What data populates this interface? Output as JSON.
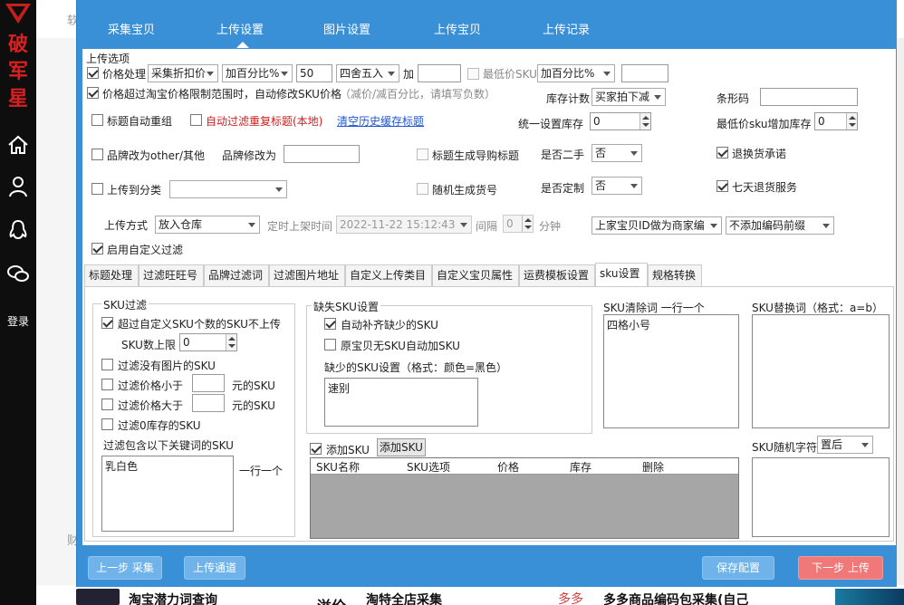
{
  "sidebar": {
    "brand_chars": [
      "破",
      "军",
      "星"
    ],
    "login_label": "登录"
  },
  "background": {
    "top_char": "软",
    "side_char": "财",
    "bottom": [
      "淘宝潜力词查询",
      "溢价",
      "淘特全店采集",
      "多多",
      "多多商品编码包采集(自己"
    ]
  },
  "dialog": {
    "tabs": [
      "采集宝贝",
      "上传设置",
      "图片设置",
      "上传宝贝",
      "上传记录"
    ],
    "active_tab": 1,
    "section_title": "上传选项",
    "price": {
      "label": "价格处理",
      "checked": true,
      "mode": "采集折扣价",
      "calc": "加百分比%",
      "value": "50",
      "rounding": "四舍五入",
      "add_label": "加",
      "add_value": "",
      "min_label": "最低价SKU",
      "min_checked": false,
      "min_mode": "加百分比%",
      "min_value": ""
    },
    "over_limit": {
      "label": "价格超过淘宝价格限制范围时，自动修改SKU价格",
      "checked": true,
      "hint": "（减价/减百分比，请填写负数）"
    },
    "stock": {
      "label": "库存计数",
      "value": "买家拍下减"
    },
    "barcode": {
      "label": "条形码",
      "value": ""
    },
    "title_regroup": {
      "label": "标题自动重组",
      "checked": false
    },
    "dedupe": {
      "label": "自动过滤重复标题(本地)",
      "checked": false
    },
    "clear_link": "清空历史缓存标题",
    "unify_stock": {
      "label": "统一设置库存",
      "value": "0"
    },
    "min_sku_stock": {
      "label": "最低价sku增加库存",
      "value": "0"
    },
    "brand_other": {
      "label": "品牌改为other/其他",
      "checked": false
    },
    "brand_change": {
      "label": "品牌修改为",
      "value": ""
    },
    "shopping_title": {
      "label": "标题生成导购标题",
      "checked": false
    },
    "second_hand": {
      "label": "是否二手",
      "value": "否"
    },
    "return_promise": {
      "label": "退换货承诺",
      "checked": true
    },
    "upload_category": {
      "label": "上传到分类",
      "checked": false,
      "value": ""
    },
    "random_code": {
      "label": "随机生成货号",
      "checked": false
    },
    "custom_made": {
      "label": "是否定制",
      "value": "否"
    },
    "seven_days": {
      "label": "七天退货服务",
      "checked": true
    },
    "upload_method": {
      "label": "上传方式",
      "value": "放入仓库"
    },
    "timed": {
      "label": "定时上架时间",
      "value": "2022-11-22 15:12:43",
      "interval_label": "间隔",
      "interval_value": "0",
      "unit": "分钟"
    },
    "merchant_code": "上家宝贝ID做为商家编",
    "prefix": "不添加编码前缀",
    "custom_filter": {
      "label": "启用自定义过滤",
      "checked": true
    },
    "subtabs": [
      "标题处理",
      "过滤旺旺号",
      "品牌过滤词",
      "过滤图片地址",
      "自定义上传类目",
      "自定义宝贝属性",
      "运费模板设置",
      "sku设置",
      "规格转换"
    ],
    "active_subtab": 7,
    "sku_filter": {
      "legend": "SKU过滤",
      "over_limit": {
        "label": "超过自定义SKU个数的SKU不上传",
        "checked": true
      },
      "limit": {
        "label": "SKU数上限",
        "value": "0"
      },
      "no_image": {
        "label": "过滤没有图片的SKU",
        "checked": false
      },
      "price_less": {
        "label": "过滤价格小于",
        "value": "",
        "unit": "元的SKU",
        "checked": false
      },
      "price_more": {
        "label": "过滤价格大于",
        "value": "",
        "unit": "元的SKU",
        "checked": false
      },
      "zero_stock": {
        "label": "过滤0库存的SKU",
        "checked": false
      },
      "keywords_label": "过滤包含以下关键词的SKU",
      "keywords": "乳白色",
      "per_line": "一行一个"
    },
    "missing_sku": {
      "legend": "缺失SKU设置",
      "auto_fill": {
        "label": "自动补齐缺少的SKU",
        "checked": true
      },
      "auto_add": {
        "label": "原宝贝无SKU自动加SKU",
        "checked": false
      },
      "settings_label": "缺少的SKU设置（格式：颜色=黑色）",
      "settings_value": "速别"
    },
    "add_sku": {
      "label": "添加SKU",
      "checked": true,
      "button": "添加SKU"
    },
    "sku_table_headers": [
      "SKU名称",
      "SKU选项",
      "价格",
      "库存",
      "删除"
    ],
    "sku_clear": {
      "label": "SKU清除词 一行一个",
      "value": "四格小号"
    },
    "sku_replace": {
      "label": "SKU替换词（格式：a=b）",
      "value": ""
    },
    "sku_random": {
      "label": "SKU随机字符",
      "value": "置后"
    },
    "footer": {
      "prev": "上一步 采集",
      "channel": "上传通道",
      "save": "保存配置",
      "next": "下一步 上传"
    }
  }
}
